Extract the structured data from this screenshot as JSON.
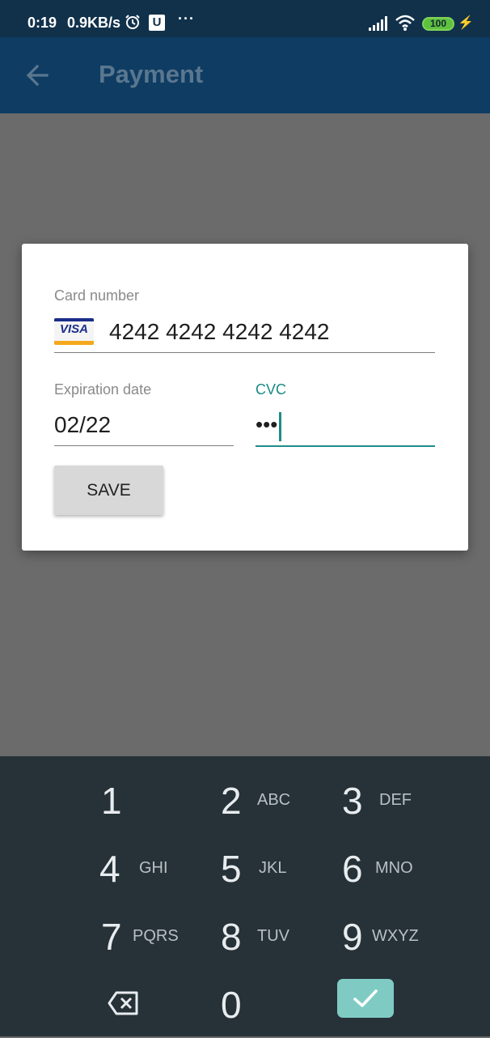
{
  "status_bar": {
    "time": "0:19",
    "net_speed": "0.9KB/s",
    "u_badge": "U",
    "more": "···",
    "battery": "100",
    "icons": [
      "alarm-icon",
      "u-icon",
      "more-icon",
      "signal-icon",
      "wifi-icon",
      "battery-icon",
      "charging-icon"
    ]
  },
  "app_bar": {
    "title": "Payment",
    "back_icon": "arrow-left-icon"
  },
  "form": {
    "card_number_label": "Card number",
    "card_brand": "VISA",
    "card_number_value": "4242 4242 4242 4242",
    "expiration_label": "Expiration date",
    "expiration_value": "02/22",
    "cvc_label": "CVC",
    "cvc_value": "•••",
    "save_label": "SAVE"
  },
  "keypad": {
    "keys": [
      {
        "digit": "1",
        "letters": ""
      },
      {
        "digit": "2",
        "letters": "ABC"
      },
      {
        "digit": "3",
        "letters": "DEF"
      },
      {
        "digit": "4",
        "letters": "GHI"
      },
      {
        "digit": "5",
        "letters": "JKL"
      },
      {
        "digit": "6",
        "letters": "MNO"
      },
      {
        "digit": "7",
        "letters": "PQRS"
      },
      {
        "digit": "8",
        "letters": "TUV"
      },
      {
        "digit": "9",
        "letters": "WXYZ"
      },
      {
        "digit": "0",
        "letters": ""
      }
    ],
    "backspace_icon": "backspace-icon",
    "done_icon": "checkmark-icon"
  },
  "colors": {
    "status_bar": "#11314b",
    "app_bar": "#0f3c62",
    "scrim": "#6b6b6b",
    "accent": "#1f8c88",
    "keypad_bg": "#263238",
    "done_key": "#7fcbc4"
  }
}
